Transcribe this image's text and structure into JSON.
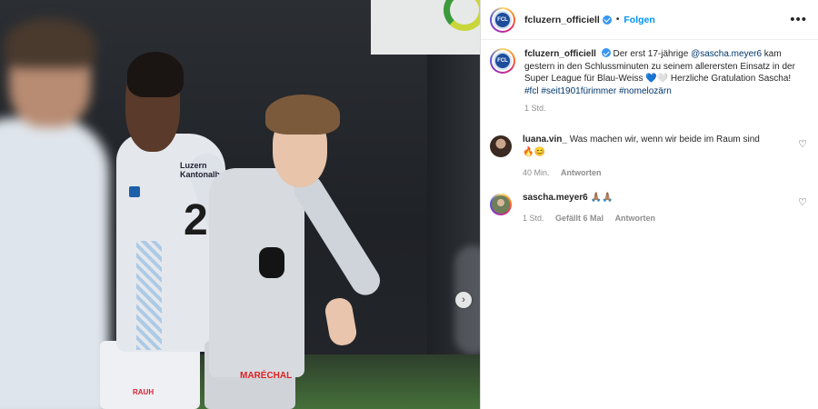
{
  "post": {
    "account": "fcluzern_officiell",
    "follow_label": "Folgen",
    "more_label": "•••",
    "separator": "•"
  },
  "caption": {
    "user": "fcluzern_officiell",
    "text_1": "Der erst 17-jährige ",
    "mention": "@sascha.meyer6",
    "text_2": " kam gestern in den Schlussminuten zu seinem allerersten Einsatz in der Super League für Blau-Weiss ",
    "hearts": "💙🤍",
    "text_3": " Herzliche Gratulation Sascha!",
    "hashtags": [
      {
        "label": "#fcl"
      },
      {
        "label": "#seit1901fürimmer"
      },
      {
        "label": "#nomelozärn"
      }
    ],
    "time": "1 Std."
  },
  "comments": [
    {
      "user": "luana.vin_",
      "text": "Was machen wir, wenn wir beide im Raum sind 🔥😊",
      "time": "40 Min.",
      "likes": "",
      "reply_label": "Antworten",
      "like_icon": "heart-outline-icon"
    },
    {
      "user": "sascha.meyer6",
      "text": "🙏🏽🙏🏽",
      "time": "1 Std.",
      "likes": "Gefällt 6 Mal",
      "reply_label": "Antworten",
      "like_icon": "heart-outline-icon"
    }
  ],
  "media": {
    "logo_text": "FCL",
    "jersey_number": "21",
    "sponsor_top": "Luzern\nKantonalbank",
    "sponsor_shorts": "RAUH",
    "sponsor_right": "MARÉCHAL",
    "next_icon": "chevron-right-icon"
  },
  "colors": {
    "accent": "#0095f6",
    "verified": "#3897f0",
    "link": "#00376b",
    "muted": "#8e8e8e"
  }
}
